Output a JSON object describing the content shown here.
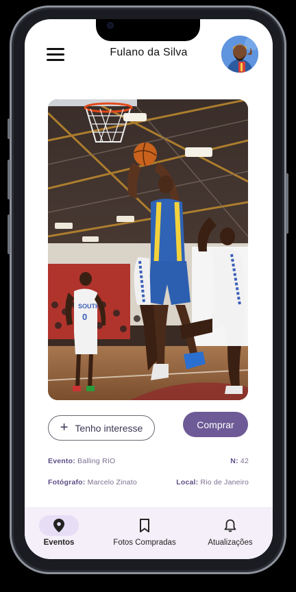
{
  "header": {
    "user_name": "Fulano da Silva"
  },
  "photo": {
    "description_icon": "basketball-photo"
  },
  "actions": {
    "interest_label": "Tenho interesse",
    "buy_label": "Comprar"
  },
  "details": {
    "event_key": "Evento:",
    "event_value": "Balling RIO",
    "number_key": "N:",
    "number_value": "42",
    "photographer_key": "Fotógrafo:",
    "photographer_value": "Marcelo Zinato",
    "location_key": "Local:",
    "location_value": "Rio de Janeiro"
  },
  "bottom_nav": {
    "items": [
      {
        "label": "Eventos",
        "icon": "location-pin-icon",
        "active": true
      },
      {
        "label": "Fotos Compradas",
        "icon": "bookmark-icon",
        "active": false
      },
      {
        "label": "Atualizações",
        "icon": "bell-icon",
        "active": false
      }
    ]
  },
  "colors": {
    "accent": "#6d5a96",
    "nav_bg": "#f4eff8",
    "nav_active_pill": "#e7ddf5"
  }
}
